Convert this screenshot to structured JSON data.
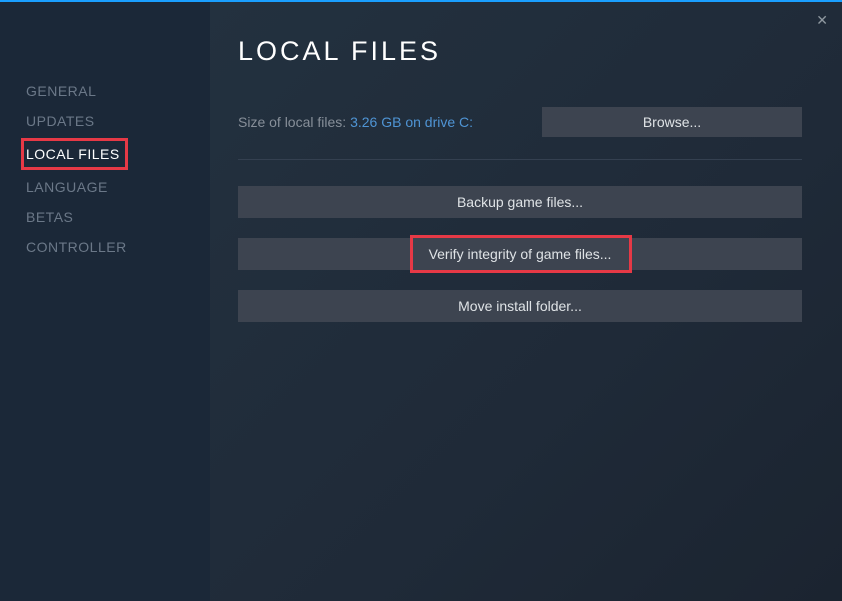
{
  "sidebar": {
    "items": [
      {
        "label": "GENERAL"
      },
      {
        "label": "UPDATES"
      },
      {
        "label": "LOCAL FILES"
      },
      {
        "label": "LANGUAGE"
      },
      {
        "label": "BETAS"
      },
      {
        "label": "CONTROLLER"
      }
    ]
  },
  "main": {
    "title": "LOCAL FILES",
    "size_label": "Size of local files: ",
    "size_value": "3.26 GB on drive C:",
    "browse_label": "Browse...",
    "backup_label": "Backup game files...",
    "verify_label": "Verify integrity of game files...",
    "move_label": "Move install folder..."
  },
  "close_symbol": "✕"
}
